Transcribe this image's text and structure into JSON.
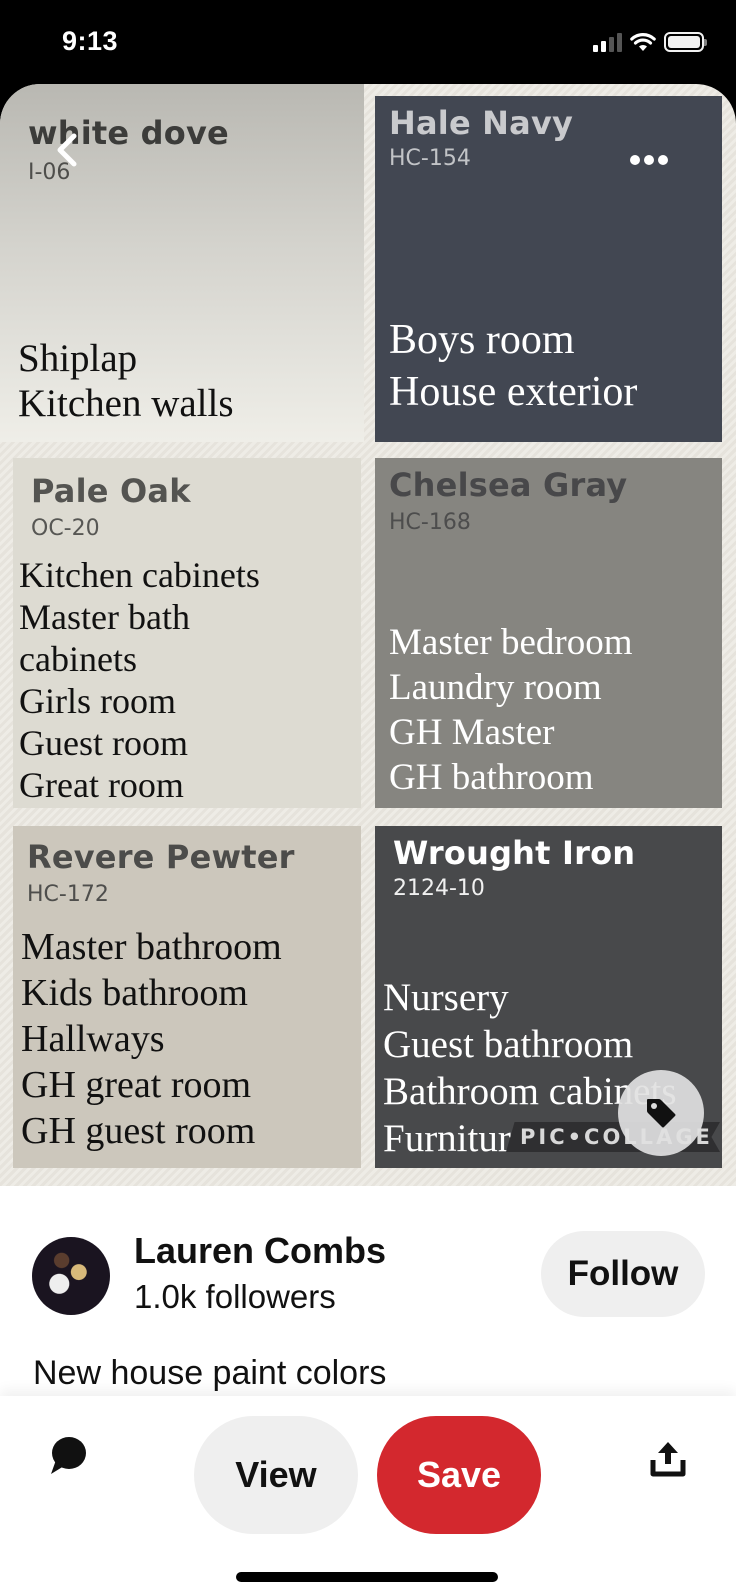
{
  "status_bar": {
    "time": "9:13",
    "signal_bars": 2,
    "signal_total": 4,
    "battery_level": 1.0
  },
  "pin": {
    "swatches": [
      {
        "id": "white-dove",
        "name": "white dove",
        "code": "I-06",
        "uses": [
          "Shiplap",
          "Kitchen walls"
        ],
        "color": "#d4d3cd"
      },
      {
        "id": "hale-navy",
        "name": "Hale Navy",
        "code": "HC-154",
        "uses": [
          "Boys room",
          "House exterior"
        ],
        "color": "#424752"
      },
      {
        "id": "pale-oak",
        "name": "Pale Oak",
        "code": "OC-20",
        "uses": [
          "Kitchen cabinets",
          "Master bath",
          "cabinets",
          "Girls room",
          "Guest room",
          "Great room"
        ],
        "color": "#dddbd2"
      },
      {
        "id": "chelsea-gray",
        "name": "Chelsea Gray",
        "code": "HC-168",
        "uses": [
          "Master bedroom",
          "Laundry room",
          "GH Master",
          "GH bathroom"
        ],
        "color": "#868580"
      },
      {
        "id": "revere-pewter",
        "name": "Revere Pewter",
        "code": "HC-172",
        "uses": [
          "Master bathroom",
          "Kids bathroom",
          "Hallways",
          "GH great room",
          "GH guest room"
        ],
        "color": "#ccc7bc"
      },
      {
        "id": "wrought-iron",
        "name": "Wrought Iron",
        "code": "2124-10",
        "uses": [
          "Nursery",
          "Guest bathroom",
          "Bathroom cabinets",
          "Furniture accents"
        ],
        "color": "#48494b"
      }
    ],
    "watermark": "PIC•COLLAGE",
    "icons": {
      "back": "chevron-left-icon",
      "more": "more-horizontal-icon",
      "tag": "tag-icon"
    }
  },
  "author": {
    "name": "Lauren Combs",
    "followers": "1.0k followers",
    "follow_label": "Follow"
  },
  "description": "New house paint colors",
  "actions": {
    "view_label": "View",
    "save_label": "Save",
    "comment_icon": "comment-icon",
    "share_icon": "share-icon",
    "save_color": "#d3282e"
  }
}
